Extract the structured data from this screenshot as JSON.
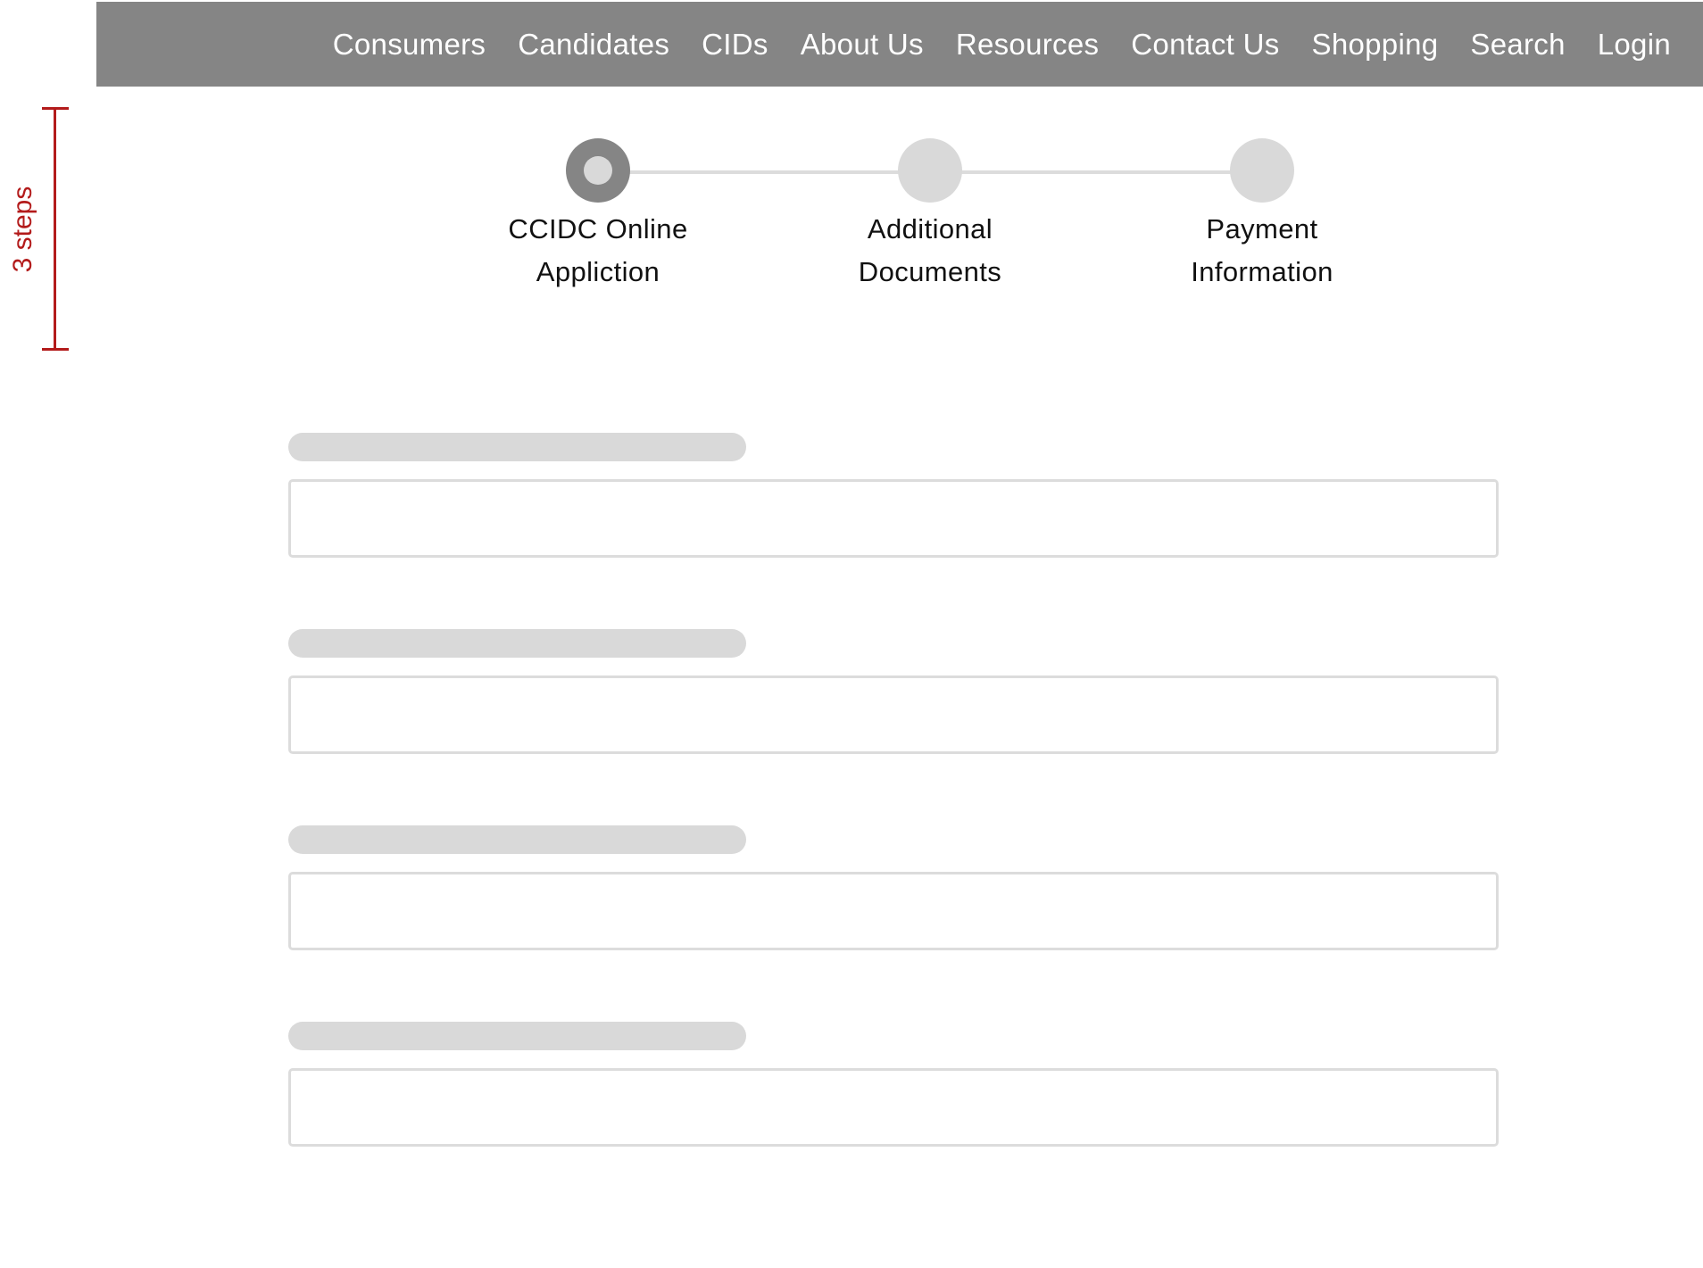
{
  "nav": {
    "items": [
      {
        "label": "Consumers"
      },
      {
        "label": "Candidates"
      },
      {
        "label": "CIDs"
      },
      {
        "label": "About Us"
      },
      {
        "label": "Resources"
      },
      {
        "label": "Contact Us"
      },
      {
        "label": "Shopping"
      },
      {
        "label": "Search"
      },
      {
        "label": "Login"
      }
    ]
  },
  "annotation": {
    "label": "3 steps"
  },
  "stepper": {
    "steps": [
      {
        "line1": "CCIDC Online",
        "line2": "Appliction",
        "active": true
      },
      {
        "line1": "Additional",
        "line2": "Documents",
        "active": false
      },
      {
        "line1": "Payment",
        "line2": "Information",
        "active": false
      }
    ]
  },
  "form": {
    "fields": [
      {
        "label": "",
        "value": ""
      },
      {
        "label": "",
        "value": ""
      },
      {
        "label": "",
        "value": ""
      },
      {
        "label": "",
        "value": ""
      }
    ]
  },
  "colors": {
    "navbar": "#858585",
    "annotation": "#b31b1b",
    "placeholder": "#d9d9d9",
    "active_step": "#858585"
  }
}
